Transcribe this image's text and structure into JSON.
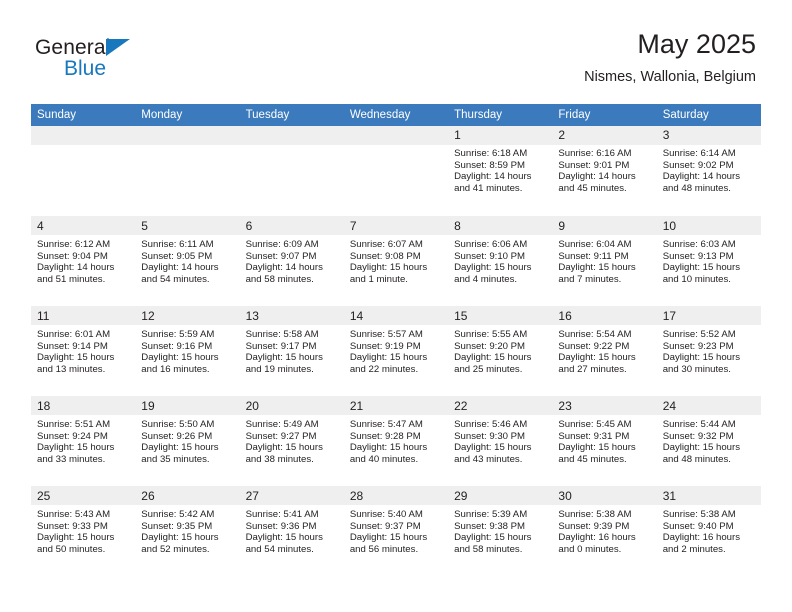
{
  "brand": {
    "name_part1": "General",
    "name_part2": "Blue",
    "colors": {
      "blue": "#1878be",
      "dark": "#231f20"
    }
  },
  "header": {
    "title": "May 2025",
    "subtitle": "Nismes, Wallonia, Belgium"
  },
  "theme": {
    "header_blue": "#3b7abc",
    "daynum_band": "#efefef",
    "text": "#231f20"
  },
  "weekdays": [
    "Sunday",
    "Monday",
    "Tuesday",
    "Wednesday",
    "Thursday",
    "Friday",
    "Saturday"
  ],
  "weeks": [
    [
      {
        "day": "",
        "empty": true
      },
      {
        "day": "",
        "empty": true
      },
      {
        "day": "",
        "empty": true
      },
      {
        "day": "",
        "empty": true
      },
      {
        "day": "1",
        "sunrise": "Sunrise: 6:18 AM",
        "sunset": "Sunset: 8:59 PM",
        "daylight_l1": "Daylight: 14 hours",
        "daylight_l2": "and 41 minutes."
      },
      {
        "day": "2",
        "sunrise": "Sunrise: 6:16 AM",
        "sunset": "Sunset: 9:01 PM",
        "daylight_l1": "Daylight: 14 hours",
        "daylight_l2": "and 45 minutes."
      },
      {
        "day": "3",
        "sunrise": "Sunrise: 6:14 AM",
        "sunset": "Sunset: 9:02 PM",
        "daylight_l1": "Daylight: 14 hours",
        "daylight_l2": "and 48 minutes."
      }
    ],
    [
      {
        "day": "4",
        "sunrise": "Sunrise: 6:12 AM",
        "sunset": "Sunset: 9:04 PM",
        "daylight_l1": "Daylight: 14 hours",
        "daylight_l2": "and 51 minutes."
      },
      {
        "day": "5",
        "sunrise": "Sunrise: 6:11 AM",
        "sunset": "Sunset: 9:05 PM",
        "daylight_l1": "Daylight: 14 hours",
        "daylight_l2": "and 54 minutes."
      },
      {
        "day": "6",
        "sunrise": "Sunrise: 6:09 AM",
        "sunset": "Sunset: 9:07 PM",
        "daylight_l1": "Daylight: 14 hours",
        "daylight_l2": "and 58 minutes."
      },
      {
        "day": "7",
        "sunrise": "Sunrise: 6:07 AM",
        "sunset": "Sunset: 9:08 PM",
        "daylight_l1": "Daylight: 15 hours",
        "daylight_l2": "and 1 minute."
      },
      {
        "day": "8",
        "sunrise": "Sunrise: 6:06 AM",
        "sunset": "Sunset: 9:10 PM",
        "daylight_l1": "Daylight: 15 hours",
        "daylight_l2": "and 4 minutes."
      },
      {
        "day": "9",
        "sunrise": "Sunrise: 6:04 AM",
        "sunset": "Sunset: 9:11 PM",
        "daylight_l1": "Daylight: 15 hours",
        "daylight_l2": "and 7 minutes."
      },
      {
        "day": "10",
        "sunrise": "Sunrise: 6:03 AM",
        "sunset": "Sunset: 9:13 PM",
        "daylight_l1": "Daylight: 15 hours",
        "daylight_l2": "and 10 minutes."
      }
    ],
    [
      {
        "day": "11",
        "sunrise": "Sunrise: 6:01 AM",
        "sunset": "Sunset: 9:14 PM",
        "daylight_l1": "Daylight: 15 hours",
        "daylight_l2": "and 13 minutes."
      },
      {
        "day": "12",
        "sunrise": "Sunrise: 5:59 AM",
        "sunset": "Sunset: 9:16 PM",
        "daylight_l1": "Daylight: 15 hours",
        "daylight_l2": "and 16 minutes."
      },
      {
        "day": "13",
        "sunrise": "Sunrise: 5:58 AM",
        "sunset": "Sunset: 9:17 PM",
        "daylight_l1": "Daylight: 15 hours",
        "daylight_l2": "and 19 minutes."
      },
      {
        "day": "14",
        "sunrise": "Sunrise: 5:57 AM",
        "sunset": "Sunset: 9:19 PM",
        "daylight_l1": "Daylight: 15 hours",
        "daylight_l2": "and 22 minutes."
      },
      {
        "day": "15",
        "sunrise": "Sunrise: 5:55 AM",
        "sunset": "Sunset: 9:20 PM",
        "daylight_l1": "Daylight: 15 hours",
        "daylight_l2": "and 25 minutes."
      },
      {
        "day": "16",
        "sunrise": "Sunrise: 5:54 AM",
        "sunset": "Sunset: 9:22 PM",
        "daylight_l1": "Daylight: 15 hours",
        "daylight_l2": "and 27 minutes."
      },
      {
        "day": "17",
        "sunrise": "Sunrise: 5:52 AM",
        "sunset": "Sunset: 9:23 PM",
        "daylight_l1": "Daylight: 15 hours",
        "daylight_l2": "and 30 minutes."
      }
    ],
    [
      {
        "day": "18",
        "sunrise": "Sunrise: 5:51 AM",
        "sunset": "Sunset: 9:24 PM",
        "daylight_l1": "Daylight: 15 hours",
        "daylight_l2": "and 33 minutes."
      },
      {
        "day": "19",
        "sunrise": "Sunrise: 5:50 AM",
        "sunset": "Sunset: 9:26 PM",
        "daylight_l1": "Daylight: 15 hours",
        "daylight_l2": "and 35 minutes."
      },
      {
        "day": "20",
        "sunrise": "Sunrise: 5:49 AM",
        "sunset": "Sunset: 9:27 PM",
        "daylight_l1": "Daylight: 15 hours",
        "daylight_l2": "and 38 minutes."
      },
      {
        "day": "21",
        "sunrise": "Sunrise: 5:47 AM",
        "sunset": "Sunset: 9:28 PM",
        "daylight_l1": "Daylight: 15 hours",
        "daylight_l2": "and 40 minutes."
      },
      {
        "day": "22",
        "sunrise": "Sunrise: 5:46 AM",
        "sunset": "Sunset: 9:30 PM",
        "daylight_l1": "Daylight: 15 hours",
        "daylight_l2": "and 43 minutes."
      },
      {
        "day": "23",
        "sunrise": "Sunrise: 5:45 AM",
        "sunset": "Sunset: 9:31 PM",
        "daylight_l1": "Daylight: 15 hours",
        "daylight_l2": "and 45 minutes."
      },
      {
        "day": "24",
        "sunrise": "Sunrise: 5:44 AM",
        "sunset": "Sunset: 9:32 PM",
        "daylight_l1": "Daylight: 15 hours",
        "daylight_l2": "and 48 minutes."
      }
    ],
    [
      {
        "day": "25",
        "sunrise": "Sunrise: 5:43 AM",
        "sunset": "Sunset: 9:33 PM",
        "daylight_l1": "Daylight: 15 hours",
        "daylight_l2": "and 50 minutes."
      },
      {
        "day": "26",
        "sunrise": "Sunrise: 5:42 AM",
        "sunset": "Sunset: 9:35 PM",
        "daylight_l1": "Daylight: 15 hours",
        "daylight_l2": "and 52 minutes."
      },
      {
        "day": "27",
        "sunrise": "Sunrise: 5:41 AM",
        "sunset": "Sunset: 9:36 PM",
        "daylight_l1": "Daylight: 15 hours",
        "daylight_l2": "and 54 minutes."
      },
      {
        "day": "28",
        "sunrise": "Sunrise: 5:40 AM",
        "sunset": "Sunset: 9:37 PM",
        "daylight_l1": "Daylight: 15 hours",
        "daylight_l2": "and 56 minutes."
      },
      {
        "day": "29",
        "sunrise": "Sunrise: 5:39 AM",
        "sunset": "Sunset: 9:38 PM",
        "daylight_l1": "Daylight: 15 hours",
        "daylight_l2": "and 58 minutes."
      },
      {
        "day": "30",
        "sunrise": "Sunrise: 5:38 AM",
        "sunset": "Sunset: 9:39 PM",
        "daylight_l1": "Daylight: 16 hours",
        "daylight_l2": "and 0 minutes."
      },
      {
        "day": "31",
        "sunrise": "Sunrise: 5:38 AM",
        "sunset": "Sunset: 9:40 PM",
        "daylight_l1": "Daylight: 16 hours",
        "daylight_l2": "and 2 minutes."
      }
    ]
  ]
}
